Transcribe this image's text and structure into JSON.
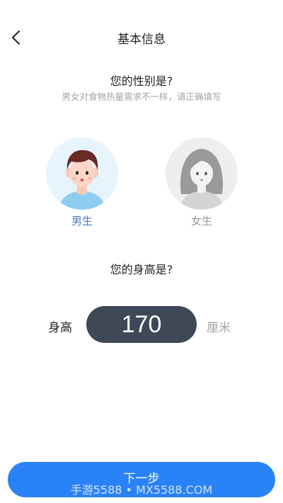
{
  "header": {
    "title": "基本信息",
    "back_icon": "chevron-left-icon"
  },
  "gender_section": {
    "question": "您的性别是?",
    "hint": "男女对食物热量需求不一样，请正确填写",
    "options": [
      {
        "label": "男生",
        "selected": true
      },
      {
        "label": "女生",
        "selected": false
      }
    ]
  },
  "height_section": {
    "question": "您的身高是?",
    "label": "身高",
    "value": "170",
    "unit": "厘米"
  },
  "footer": {
    "next_label": "下一步"
  },
  "watermark": "手游5588 • MX5588.COM",
  "colors": {
    "accent": "#2a83f6",
    "selected_label": "#4a7cc0",
    "pill_bg": "#3f4856",
    "hint": "#a3a3a3"
  }
}
